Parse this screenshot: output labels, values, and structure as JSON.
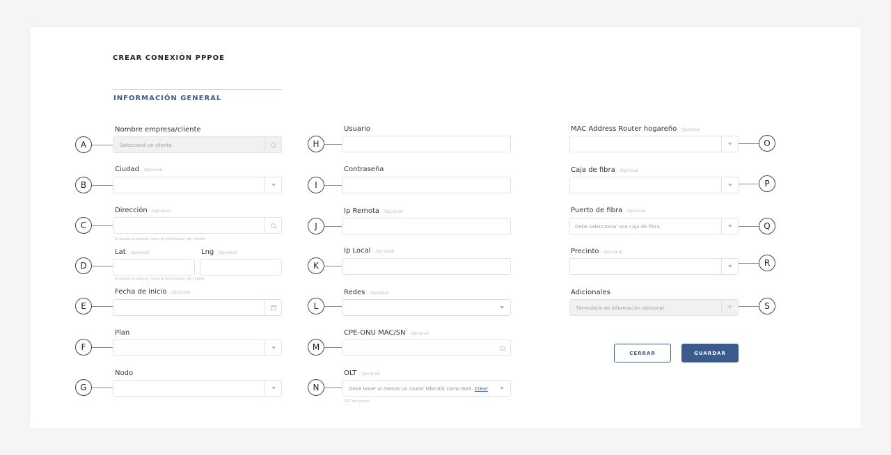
{
  "page": {
    "title": "CREAR CONEXIÓN PPPOE",
    "section": "INFORMACIÓN GENERAL",
    "optional_tag": "- Opcional"
  },
  "left": {
    "client": {
      "marker": "A",
      "label": "Nombre empresa/cliente",
      "placeholder": "Seleccioná un cliente."
    },
    "city": {
      "marker": "B",
      "label": "Ciudad"
    },
    "address": {
      "marker": "C",
      "label": "Dirección",
      "hint": "Si queda en blanco, toma la información del cliente."
    },
    "coords": {
      "marker": "D",
      "lat_label": "Lat",
      "lng_label": "Lng",
      "hint": "Si queda en blanco, toma la información del cliente."
    },
    "start_date": {
      "marker": "E",
      "label": "Fecha de inicio"
    },
    "plan": {
      "marker": "F",
      "label": "Plan"
    },
    "node": {
      "marker": "G",
      "label": "Nodo"
    }
  },
  "middle": {
    "user": {
      "marker": "H",
      "label": "Usuario"
    },
    "password": {
      "marker": "I",
      "label": "Contraseña"
    },
    "remote_ip": {
      "marker": "J",
      "label": "Ip Remota"
    },
    "local_ip": {
      "marker": "K",
      "label": "Ip Local"
    },
    "networks": {
      "marker": "L",
      "label": "Redes"
    },
    "cpe": {
      "marker": "M",
      "label": "CPE-ONU MAC/SN"
    },
    "olt": {
      "marker": "N",
      "label": "OLT",
      "placeholder": "Debe tener al menos un router Mikrotik como NAS.",
      "link": "Crear",
      "hint": "OLT de acceso"
    }
  },
  "right": {
    "mac": {
      "marker": "O",
      "label": "MAC Address Router hogareño"
    },
    "fiber_box": {
      "marker": "P",
      "label": "Caja de fibra"
    },
    "fiber_port": {
      "marker": "Q",
      "label": "Puerto de fibra",
      "placeholder": "Debe seleccionar una caja de fibra."
    },
    "seal": {
      "marker": "R",
      "label": "Precinto"
    },
    "additional": {
      "marker": "S",
      "label": "Adicionales",
      "placeholder": "Formulario de información adicional"
    }
  },
  "actions": {
    "close_label": "CERRAR",
    "save_label": "GUARDAR"
  },
  "colors": {
    "accent": "#3c5a8c",
    "border": "#dfe2e6",
    "background": "#f5f5f5"
  },
  "icons": {
    "search": "search-icon",
    "dropdown": "chevron-down-icon",
    "calendar": "calendar-icon",
    "add": "plus-icon"
  }
}
